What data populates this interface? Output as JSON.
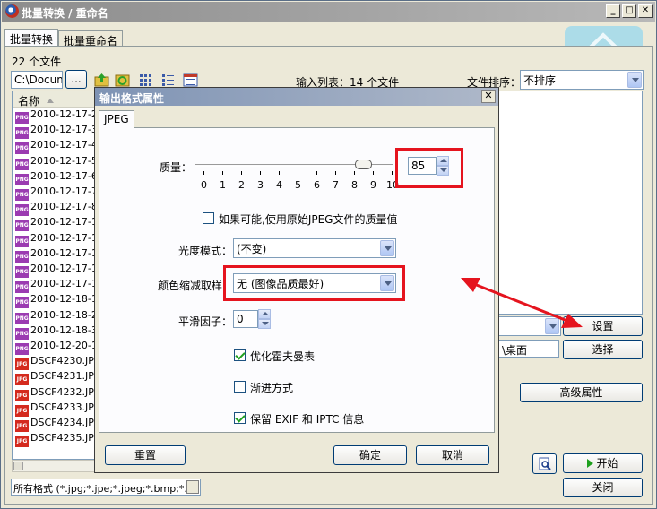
{
  "window": {
    "title": "批量转换 / 重命名",
    "controls": {
      "minimize": "_",
      "maximize": "□",
      "close": "✕"
    }
  },
  "tabs": [
    {
      "label": "批量转换"
    },
    {
      "label": "批量重命名"
    }
  ],
  "file_count": "22 个文件",
  "path_value": "C:\\Docume",
  "browse_label": "...",
  "input_list_label": "输入列表：14 个文件",
  "sort": {
    "label": "文件排序：",
    "value": "不排序"
  },
  "file_list": {
    "header": "名称",
    "items": [
      {
        "name": "2010-12-17-2.",
        "type": "png"
      },
      {
        "name": "2010-12-17-3.",
        "type": "png"
      },
      {
        "name": "2010-12-17-4.",
        "type": "png"
      },
      {
        "name": "2010-12-17-5.",
        "type": "png"
      },
      {
        "name": "2010-12-17-6.",
        "type": "png"
      },
      {
        "name": "2010-12-17-7.",
        "type": "png"
      },
      {
        "name": "2010-12-17-8.",
        "type": "png"
      },
      {
        "name": "2010-12-17-10",
        "type": "png"
      },
      {
        "name": "2010-12-17-11",
        "type": "png"
      },
      {
        "name": "2010-12-17-12",
        "type": "png"
      },
      {
        "name": "2010-12-17-13",
        "type": "png"
      },
      {
        "name": "2010-12-17-14",
        "type": "png"
      },
      {
        "name": "2010-12-18-1.",
        "type": "png"
      },
      {
        "name": "2010-12-18-2.",
        "type": "png"
      },
      {
        "name": "2010-12-18-3.",
        "type": "png"
      },
      {
        "name": "2010-12-20-1.",
        "type": "png"
      },
      {
        "name": "DSCF4230.JPG",
        "type": "jpg"
      },
      {
        "name": "DSCF4231.JPG",
        "type": "jpg"
      },
      {
        "name": "DSCF4232.JPG",
        "type": "jpg"
      },
      {
        "name": "DSCF4233.JPG",
        "type": "jpg"
      },
      {
        "name": "DSCF4234.JPG",
        "type": "jpg"
      },
      {
        "name": "DSCF4235.JPG",
        "type": "jpg"
      }
    ]
  },
  "file_filter": "所有格式 (*.jpg;*.jpe;*.jpeg;*.bmp;*.",
  "right_panel": {
    "settings_button": "设置",
    "output_folder_value": "\\桌面",
    "select_button": "选择",
    "advanced_button": "高级属性",
    "start_button": "开始",
    "close_button": "关闭"
  },
  "dialog": {
    "title": "输出格式属性",
    "close": "✕",
    "tab": "JPEG",
    "quality": {
      "label": "质量：",
      "value": "85",
      "ticks": [
        "0",
        "1",
        "2",
        "3",
        "4",
        "5",
        "6",
        "7",
        "8",
        "9",
        "10"
      ],
      "level": 8.5
    },
    "use_original_quality": "如果可能,使用原始JPEG文件的质量值",
    "gloss_mode": {
      "label": "光度模式：",
      "value": "(不变)"
    },
    "color_subsampling": {
      "label": "颜色缩减取样：",
      "value": "无 (图像品质最好)"
    },
    "smoothing": {
      "label": "平滑因子：",
      "value": "0"
    },
    "optimize_huffman": "优化霍夫曼表",
    "progressive": "渐进方式",
    "keep_exif": "保留 EXIF 和 IPTC 信息",
    "reset_button": "重置",
    "ok_button": "确定",
    "cancel_button": "取消"
  },
  "colors": {
    "highlight_box": "#e5141e",
    "arrow": "#e5141e"
  }
}
